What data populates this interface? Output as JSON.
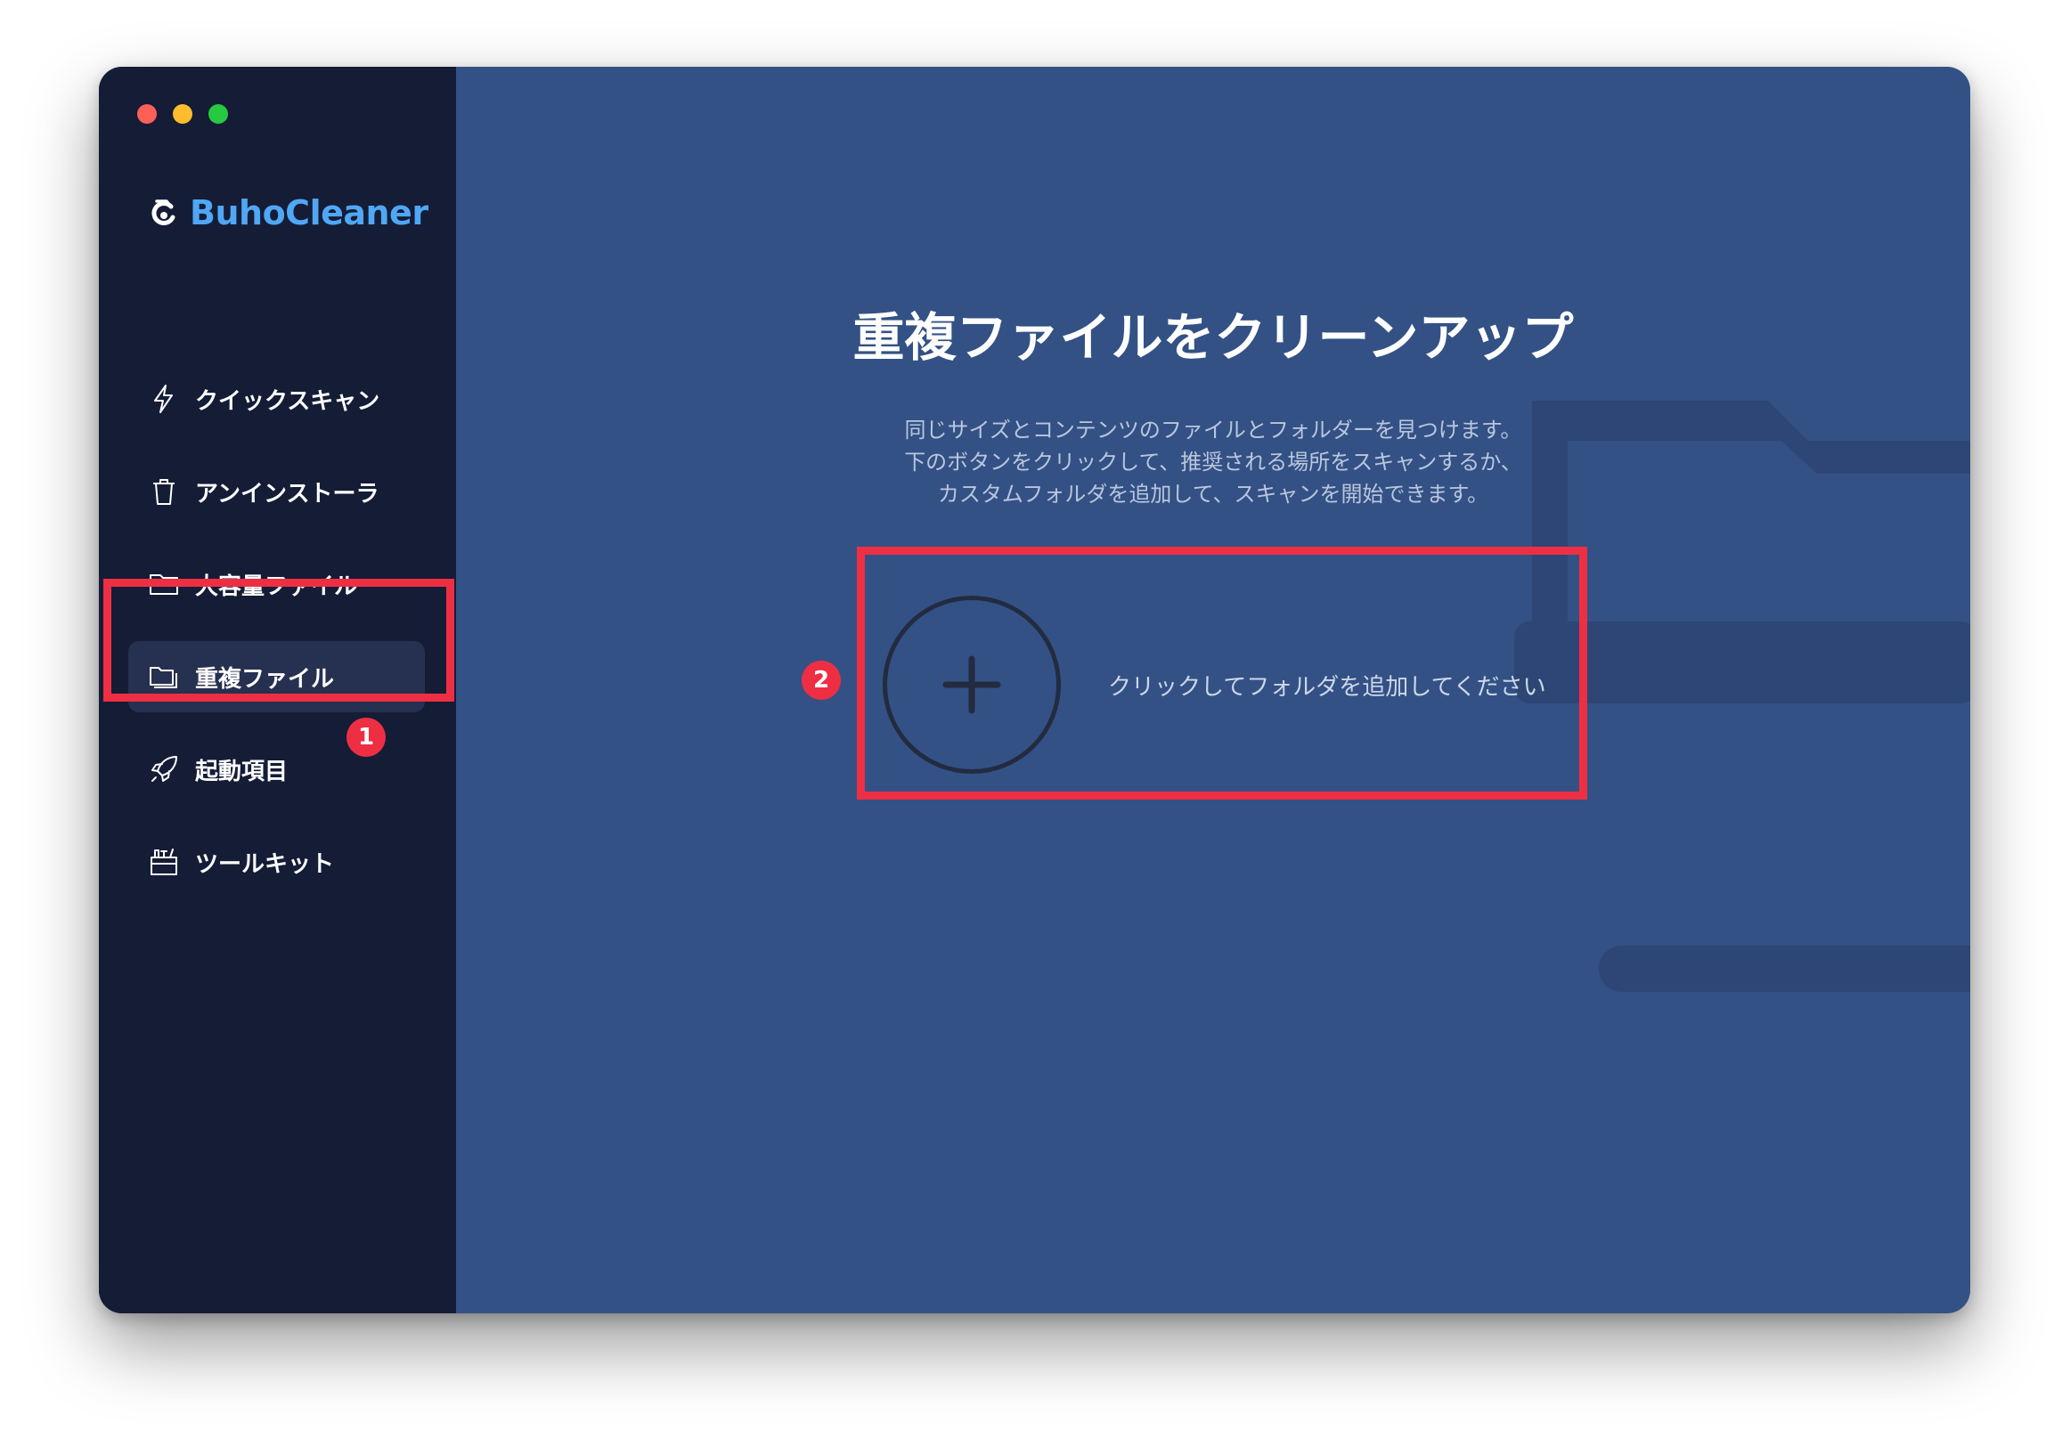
{
  "app": {
    "name": "BuhoCleaner",
    "brand_color": "#4fa7f5",
    "logo_icon": "buho-logo-icon"
  },
  "window_controls": [
    "close",
    "minimize",
    "zoom"
  ],
  "sidebar": {
    "items": [
      {
        "label": "クイックスキャン",
        "icon": "lightning-icon",
        "active": false
      },
      {
        "label": "アンインストーラ",
        "icon": "trash-icon",
        "active": false
      },
      {
        "label": "大容量ファイル",
        "icon": "folder-icon",
        "active": false
      },
      {
        "label": "重複ファイル",
        "icon": "duplicate-folder-icon",
        "active": true
      },
      {
        "label": "起動項目",
        "icon": "rocket-icon",
        "active": false
      },
      {
        "label": "ツールキット",
        "icon": "toolkit-icon",
        "active": false
      }
    ]
  },
  "main": {
    "title": "重複ファイルをクリーンアップ",
    "description_lines": [
      "同じサイズとコンテンツのファイルとフォルダーを見つけます。",
      "下のボタンをクリックして、推奨される場所をスキャンするか、",
      "カスタムフォルダを追加して、スキャンを開始できます。"
    ],
    "add_folder": {
      "icon": "plus-icon",
      "label": "クリックしてフォルダを追加してください"
    }
  },
  "annotations": {
    "badge_1": "1",
    "badge_2": "2",
    "color": "#ee2f43"
  },
  "colors": {
    "sidebar_bg": "#151c36",
    "main_bg": "#335185",
    "sidebar_active_bg": "#263050"
  }
}
